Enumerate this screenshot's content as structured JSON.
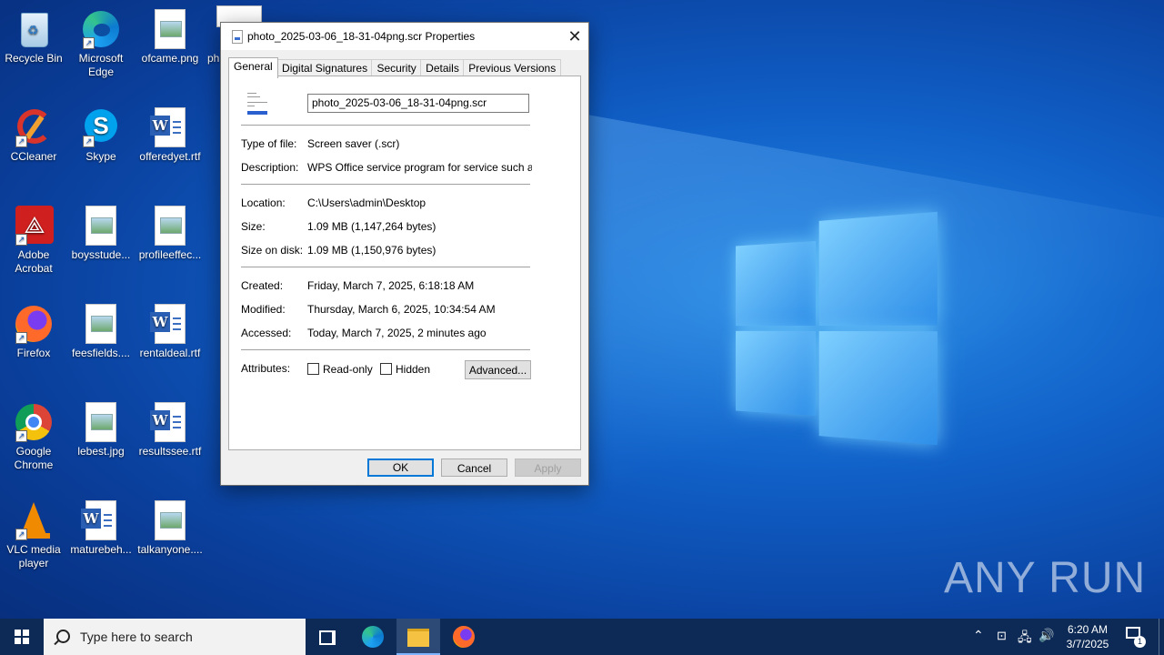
{
  "desktop": {
    "icons": [
      {
        "label": "Recycle Bin"
      },
      {
        "label": "Microsoft Edge"
      },
      {
        "label": "ofcame.png"
      },
      {
        "label": "ph"
      },
      {
        "label": "CCleaner"
      },
      {
        "label": "Skype"
      },
      {
        "label": "offeredyet.rtf"
      },
      {
        "label": "Adobe Acrobat"
      },
      {
        "label": "boysstude..."
      },
      {
        "label": "profileeffec..."
      },
      {
        "label": "Firefox"
      },
      {
        "label": "feesfields...."
      },
      {
        "label": "rentaldeal.rtf"
      },
      {
        "label": "Google Chrome"
      },
      {
        "label": "lebest.jpg"
      },
      {
        "label": "resultssee.rtf"
      },
      {
        "label": "VLC media player"
      },
      {
        "label": "maturebeh..."
      },
      {
        "label": "talkanyone...."
      }
    ],
    "watermark": "ANY RUN"
  },
  "dialog": {
    "title": "photo_2025-03-06_18-31-04png.scr Properties",
    "close_glyph": "✕",
    "tabs": [
      "General",
      "Digital Signatures",
      "Security",
      "Details",
      "Previous Versions"
    ],
    "active_tab": "General",
    "file_name": "photo_2025-03-06_18-31-04png.scr",
    "fields": {
      "type_label": "Type of file:",
      "type_value": "Screen saver (.scr)",
      "desc_label": "Description:",
      "desc_value": "WPS Office service program for service such as logi",
      "loc_label": "Location:",
      "loc_value": "C:\\Users\\admin\\Desktop",
      "size_label": "Size:",
      "size_value": "1.09 MB (1,147,264 bytes)",
      "disk_label": "Size on disk:",
      "disk_value": "1.09 MB (1,150,976 bytes)",
      "created_label": "Created:",
      "created_value": "Friday, March 7, 2025, 6:18:18 AM",
      "modified_label": "Modified:",
      "modified_value": "Thursday, March 6, 2025, 10:34:54 AM",
      "accessed_label": "Accessed:",
      "accessed_value": "Today, March 7, 2025, 2 minutes ago",
      "attr_label": "Attributes:"
    },
    "checkboxes": {
      "readonly": "Read-only",
      "hidden": "Hidden"
    },
    "buttons": {
      "advanced": "Advanced...",
      "ok": "OK",
      "cancel": "Cancel",
      "apply": "Apply"
    }
  },
  "taskbar": {
    "search_placeholder": "Type here to search",
    "time": "6:20 AM",
    "date": "3/7/2025",
    "notification_count": "1"
  }
}
